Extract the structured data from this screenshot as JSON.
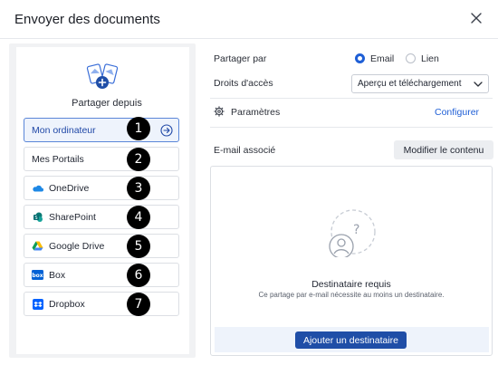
{
  "dialog": {
    "title": "Envoyer des documents"
  },
  "left": {
    "share_from_label": "Partager depuis",
    "sources": [
      {
        "label": "Mon ordinateur",
        "icon": "computer-arrow-icon",
        "number": "1",
        "active": true
      },
      {
        "label": "Mes Portails",
        "icon": "",
        "number": "2"
      },
      {
        "label": "OneDrive",
        "icon": "onedrive-icon",
        "number": "3"
      },
      {
        "label": "SharePoint",
        "icon": "sharepoint-icon",
        "number": "4"
      },
      {
        "label": "Google Drive",
        "icon": "google-drive-icon",
        "number": "5"
      },
      {
        "label": "Box",
        "icon": "box-icon",
        "number": "6"
      },
      {
        "label": "Dropbox",
        "icon": "dropbox-icon",
        "number": "7"
      }
    ]
  },
  "right": {
    "share_by_label": "Partager par",
    "share_options": {
      "email": "Email",
      "link": "Lien",
      "selected": "email"
    },
    "access_label": "Droits d'accès",
    "access_value": "Aperçu et téléchargement",
    "settings_label": "Paramètres",
    "configure_label": "Configurer",
    "email_label": "E-mail associé",
    "modify_label": "Modifier le contenu",
    "recipient": {
      "title": "Destinataire requis",
      "subtitle": "Ce partage par e-mail nécessite au moins un destinataire.",
      "add_button": "Ajouter un destinataire"
    }
  },
  "colors": {
    "accent": "#1f5fd6",
    "primary_button": "#1f4ea7",
    "active_border": "#5a86d8"
  }
}
